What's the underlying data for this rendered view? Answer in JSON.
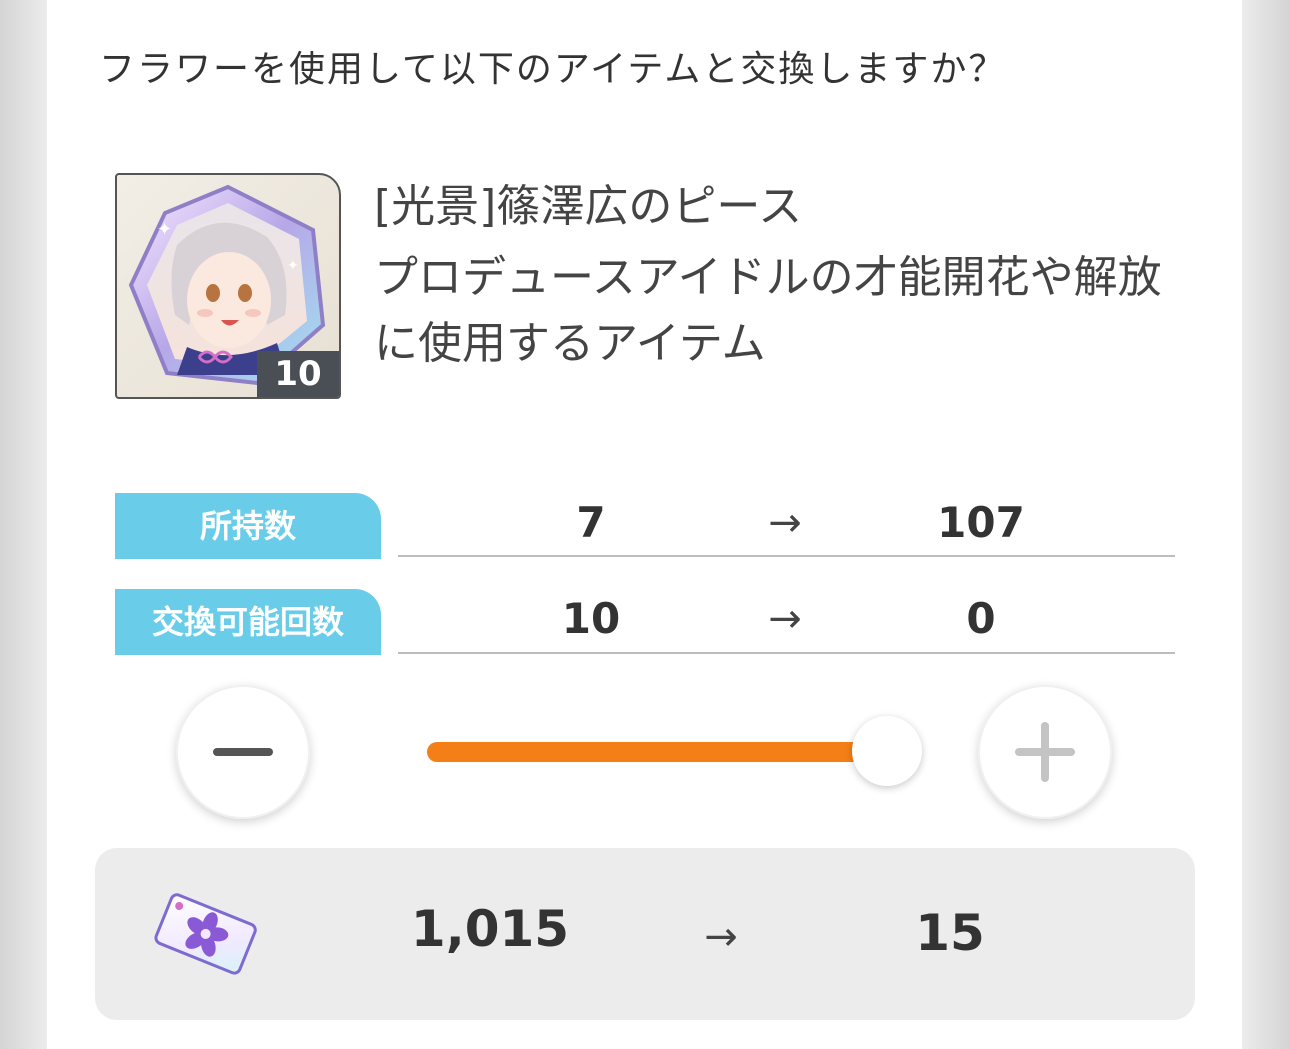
{
  "prompt": "フラワーを使用して以下のアイテムと交換しますか？",
  "item": {
    "name": "[光景]篠澤広のピース",
    "description": "プロデュースアイドルの才能開花や解放に使用するアイテム",
    "count_badge": "10"
  },
  "stats": [
    {
      "label": "所持数",
      "before": "7",
      "arrow": "→",
      "after": "107"
    },
    {
      "label": "交換可能回数",
      "before": "10",
      "arrow": "→",
      "after": "0"
    }
  ],
  "slider": {
    "value_fraction": 1.0,
    "accent_color": "#f57f17"
  },
  "cost": {
    "icon": "flower-ticket-icon",
    "before": "1,015",
    "arrow": "→",
    "after": "15"
  },
  "colors": {
    "label_bg": "#69cdea",
    "panel_bg": "#ffffff",
    "cost_bg": "#ececec"
  }
}
